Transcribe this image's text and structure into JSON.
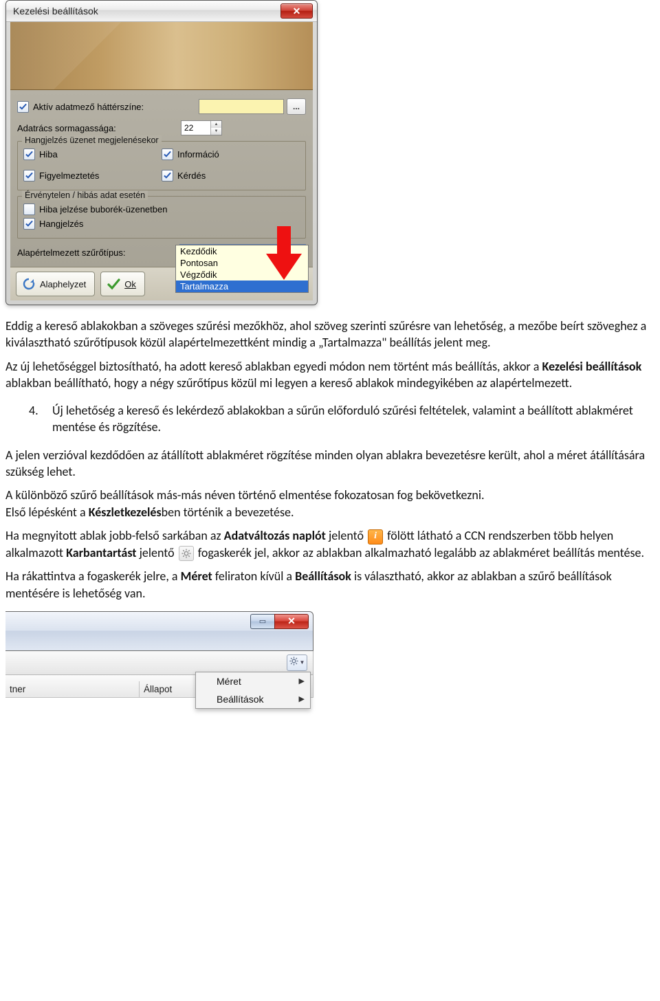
{
  "dialog": {
    "title": "Kezelési beállítások",
    "closeGlyph": "✕",
    "activeField": {
      "label": "Aktív adatmező háttérszíne:",
      "checked": true,
      "swatchColor": "#fbf3b0",
      "ellipsis": "..."
    },
    "rowHeight": {
      "label": "Adatrács sormagassága:",
      "value": "22"
    },
    "soundGroup": {
      "legend": "Hangjelzés üzenet megjelenésekor",
      "items": [
        {
          "label": "Hiba",
          "checked": true
        },
        {
          "label": "Információ",
          "checked": true
        },
        {
          "label": "Figyelmeztetés",
          "checked": true
        },
        {
          "label": "Kérdés",
          "checked": true
        }
      ]
    },
    "invalidGroup": {
      "legend": "Érvénytelen / hibás adat esetén",
      "items": [
        {
          "label": "Hiba jelzése buborék-üzenetben",
          "checked": false
        },
        {
          "label": "Hangjelzés",
          "checked": true
        }
      ]
    },
    "filter": {
      "label": "Alapértelmezett szűrőtípus:",
      "selected": "Tartalmazza",
      "options": [
        "Kezdődik",
        "Pontosan",
        "Végződik",
        "Tartalmazza"
      ]
    },
    "buttons": {
      "reset": "Alaphelyzet",
      "ok": "Ok"
    }
  },
  "text": {
    "p1a": "Eddig a kereső ablakokban a szöveges szűrési mezőkhöz, ahol szöveg szerinti szűrésre van lehetőség, a mezőbe beírt szöveghez a kiválasztható szűrőtípusok közül alapértelmezettként mindig a „Tartalmazza\" beállítás jelent meg.",
    "p1b_pre": "Az új lehetőséggel biztosítható, ha adott kereső ablakban egyedi módon nem történt más beállítás, akkor a ",
    "p1b_bold": "Kezelési beállítások",
    "p1b_post": " ablakban beállítható, hogy a négy szűrőtípus közül mi legyen a kereső ablakok mindegyikében az alapértelmezett.",
    "list_num": "4.",
    "list_item": "Új lehetőség a kereső és lekérdező ablakokban a sűrűn előforduló szűrési feltételek, valamint a beállított ablakméret mentése és rögzítése.",
    "p2": "A jelen verzióval kezdődően az átállított ablakméret rögzítése minden olyan ablakra bevezetésre került, ahol a méret átállítására szükség lehet.",
    "p3a": "A különböző szűrő beállítások más-más néven történő elmentése fokozatosan fog bekövetkezni.",
    "p3b_pre": "Első lépésként a ",
    "p3b_bold": "Készletkezelés",
    "p3b_post": "ben történik a bevezetése.",
    "p4_pre": "Ha megnyitott ablak jobb-felső sarkában az ",
    "p4_b1": "Adatváltozás naplót",
    "p4_mid1": " jelentő ",
    "p4_mid2": " fölött látható a CCN rendszerben több helyen alkalmazott ",
    "p4_b2": "Karbantartást",
    "p4_mid3": " jelentő ",
    "p4_mid4": " fogaskerék jel, akkor az ablakban alkalmazható legalább az ablakméret beállítás mentése.",
    "p5_pre": "Ha rákattintva a fogaskerék jelre, a ",
    "p5_b1": "Méret",
    "p5_mid": " feliraton kívül a ",
    "p5_b2": "Beállítások",
    "p5_post": " is választható, akkor az ablakban a szűrő beállítások mentésére is lehetőség van."
  },
  "frag": {
    "menu": [
      "Méret",
      "Beállítások"
    ],
    "cols": [
      "tner",
      "Állapot"
    ]
  }
}
